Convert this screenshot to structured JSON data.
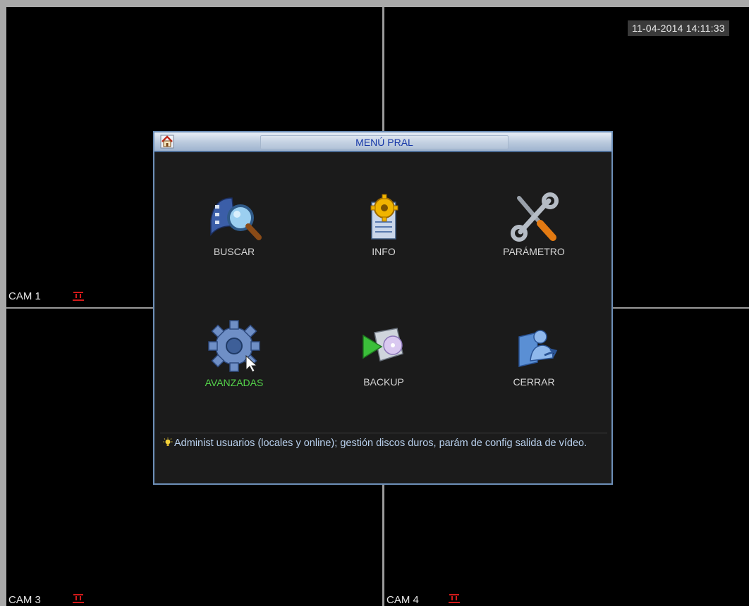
{
  "datetime": "11-04-2014 14:11:33",
  "cameras": [
    {
      "label": "CAM 1"
    },
    {
      "label": "CAM 3"
    },
    {
      "label": "CAM 4"
    }
  ],
  "dialog": {
    "title": "MENÚ PRAL",
    "items": [
      {
        "label": "BUSCAR",
        "icon": "search-film-icon"
      },
      {
        "label": "INFO",
        "icon": "info-gear-document-icon"
      },
      {
        "label": "PARÁMETRO",
        "icon": "tools-icon"
      },
      {
        "label": "AVANZADAS",
        "icon": "gear-icon",
        "selected": true
      },
      {
        "label": "BACKUP",
        "icon": "backup-disc-icon"
      },
      {
        "label": "CERRAR",
        "icon": "user-exit-icon"
      }
    ],
    "hint_text": "Administ usuarios (locales y online); gestión discos duros, parám de config salida de vídeo."
  },
  "colors": {
    "selected_label": "#54d34a",
    "hint_text": "#b9d1ee",
    "title_text": "#1738a8",
    "record_indicator": "#d21a1a"
  }
}
